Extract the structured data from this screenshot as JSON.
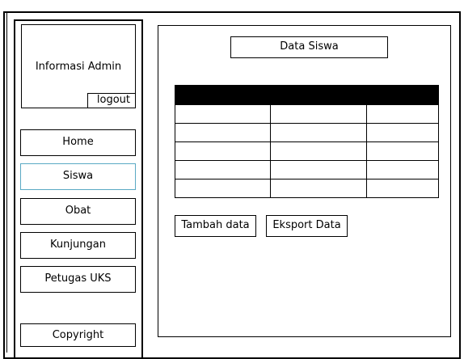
{
  "sidebar": {
    "admin_info": "Informasi Admin",
    "logout_label": "logout",
    "nav": [
      {
        "label": "Home"
      },
      {
        "label": "Siswa",
        "active": true
      },
      {
        "label": "Obat"
      },
      {
        "label": "Kunjungan"
      },
      {
        "label": "Petugas UKS"
      }
    ],
    "copyright_label": "Copyright"
  },
  "main": {
    "title": "Data Siswa",
    "table": {
      "columns": [
        "",
        "",
        ""
      ],
      "rows": [
        [
          "",
          "",
          ""
        ],
        [
          "",
          "",
          ""
        ],
        [
          "",
          "",
          ""
        ],
        [
          "",
          "",
          ""
        ],
        [
          "",
          "",
          ""
        ]
      ]
    },
    "add_label": "Tambah data",
    "export_label": "Eksport Data"
  },
  "colors": {
    "active_border": "#5aa9c4",
    "table_header": "#000000"
  }
}
